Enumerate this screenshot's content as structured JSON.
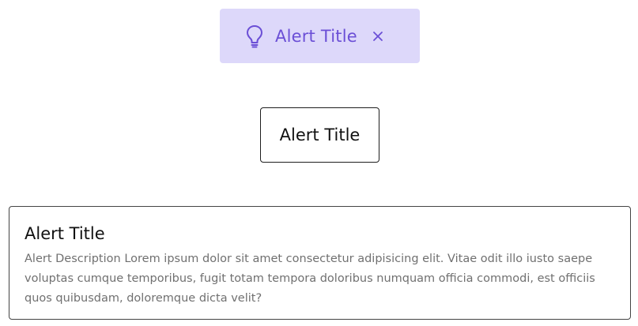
{
  "colors": {
    "pill_background": "#ddd8fa",
    "pill_accent": "#6b4fd6",
    "text_dark": "#111111",
    "text_muted": "#707070",
    "border": "#1e1e1e"
  },
  "alerts": [
    {
      "variant": "tinted",
      "icon": "lightbulb-icon",
      "title": "Alert Title",
      "close_icon": "close-icon",
      "close_glyph": "×"
    },
    {
      "variant": "outlined",
      "title": "Alert Title"
    },
    {
      "variant": "outlined-with-description",
      "title": "Alert Title",
      "description": "Alert Description Lorem ipsum dolor sit amet consectetur adipisicing elit. Vitae odit illo iusto saepe voluptas cumque temporibus, fugit totam tempora doloribus numquam officia commodi, est officiis quos quibusdam, doloremque dicta velit?"
    }
  ]
}
